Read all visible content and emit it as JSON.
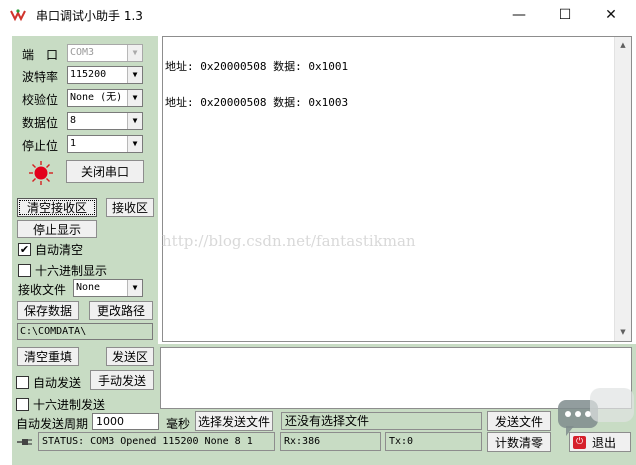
{
  "window": {
    "title": "串口调试小助手 1.3",
    "minimize_glyph": "—",
    "maximize_glyph": "☐",
    "close_glyph": "✕"
  },
  "settings": {
    "port_label": "端　口",
    "port_value": "COM3",
    "baud_label": "波特率",
    "baud_value": "115200",
    "parity_label": "校验位",
    "parity_value": "None (无)",
    "databits_label": "数据位",
    "databits_value": "8",
    "stopbits_label": "停止位",
    "stopbits_value": "1",
    "close_port_label": "关闭串口",
    "status_led_color": "#e3001b"
  },
  "receive": {
    "clear_label": "清空接收区",
    "area_label": "接收区",
    "stop_display_label": "停止显示",
    "auto_clear_label": "自动清空",
    "auto_clear_checked": true,
    "hex_display_label": "十六进制显示",
    "hex_display_checked": false,
    "file_label": "接收文件",
    "file_value": "None",
    "save_label": "保存数据",
    "change_path_label": "更改路径",
    "path_value": "C:\\COMDATA\\",
    "lines": [
      "地址: 0x20000508 数据: 0x1001",
      "地址: 0x20000508 数据: 0x1003"
    ]
  },
  "watermark": "http://blog.csdn.net/fantastikman",
  "send": {
    "clear_label": "清空重填",
    "area_label": "发送区",
    "auto_send_label": "自动发送",
    "auto_send_checked": false,
    "manual_send_label": "手动发送",
    "hex_send_label": "十六进制发送",
    "hex_send_checked": false,
    "period_label": "自动发送周期",
    "period_value": "1000",
    "ms_label": "毫秒",
    "choose_file_label": "选择发送文件",
    "file_status": "还没有选择文件",
    "send_file_label": "发送文件",
    "count_clear_label": "计数清零",
    "exit_label": "退出"
  },
  "statusbar": {
    "status": "STATUS: COM3 Opened 115200 None  8 1",
    "rx": "Rx:386",
    "tx": "Tx:0"
  },
  "colors": {
    "panel_bg": "#c8dcc4",
    "title_bg": "#ffffff"
  }
}
